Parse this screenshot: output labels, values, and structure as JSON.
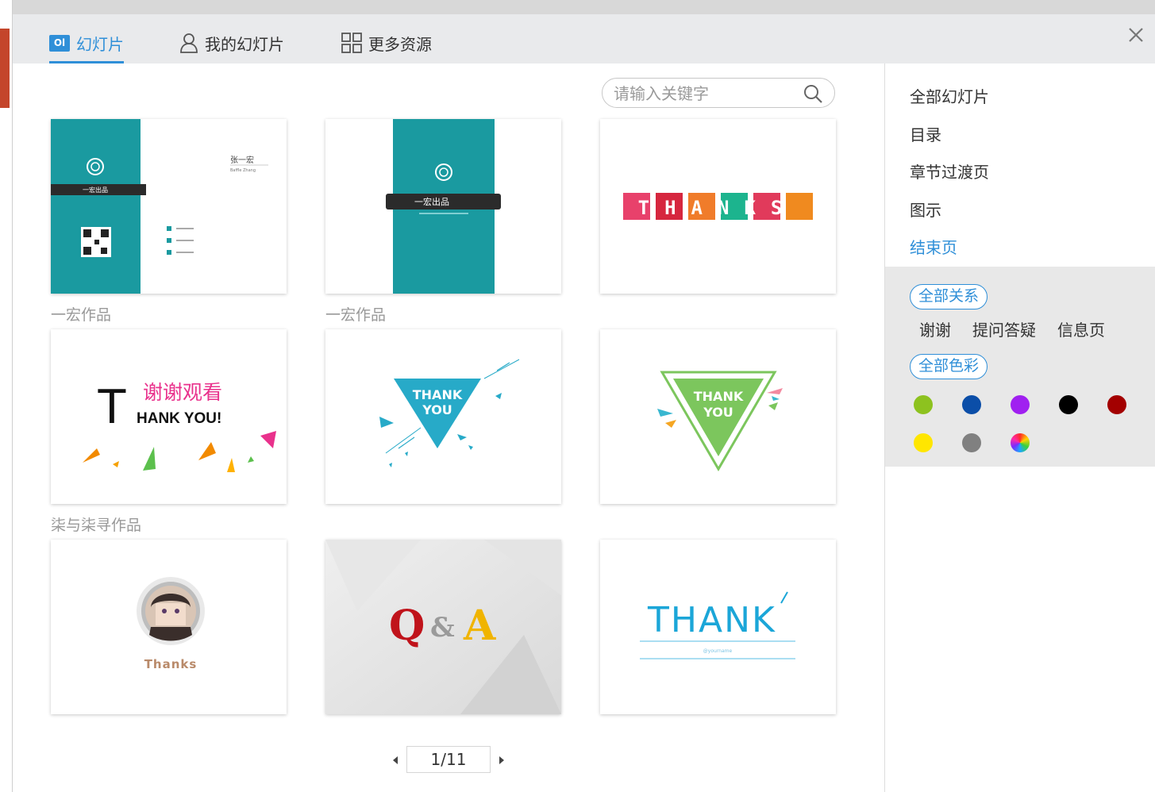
{
  "tabs": [
    {
      "label": "幻灯片",
      "icon": "slide-icon",
      "active": true
    },
    {
      "label": "我的幻灯片",
      "icon": "user-icon",
      "active": false
    },
    {
      "label": "更多资源",
      "icon": "grid-icon",
      "active": false
    }
  ],
  "tab_icon_text": "Ol",
  "search": {
    "placeholder": "请输入关键字"
  },
  "cards": [
    {
      "id": "card-1",
      "title_text": "一宏出品",
      "name_text": "张一宏",
      "name_sub": "Baffle Zhang"
    },
    {
      "id": "card-2",
      "title_text": "一宏出品"
    },
    {
      "id": "card-3",
      "text": "THANKS"
    },
    {
      "id": "card-4",
      "big_t": "T",
      "cn_text": "谢谢观看",
      "en_text": "HANK  YOU!"
    },
    {
      "id": "card-5",
      "line1": "THANK",
      "line2": "YOU"
    },
    {
      "id": "card-6",
      "line1": "THANK",
      "line2": "YOU"
    },
    {
      "id": "card-7",
      "label": "Thanks"
    },
    {
      "id": "card-8",
      "q": "Q",
      "amp": "&",
      "a": "A"
    },
    {
      "id": "card-9",
      "text": "THANK",
      "sub": "@yourname"
    }
  ],
  "authors": [
    "一宏作品",
    "一宏作品",
    "柒与柒寻作品"
  ],
  "pager": {
    "current": "1/11"
  },
  "categories": [
    {
      "label": "全部幻灯片",
      "active": false
    },
    {
      "label": "目录",
      "active": false
    },
    {
      "label": "章节过渡页",
      "active": false
    },
    {
      "label": "图示",
      "active": false
    },
    {
      "label": "结束页",
      "active": true
    }
  ],
  "relations": {
    "all_label": "全部关系",
    "items": [
      "谢谢",
      "提问答疑",
      "信息页"
    ]
  },
  "colors": {
    "all_label": "全部色彩",
    "swatches": [
      "#8dc21f",
      "#0b4ea8",
      "#a020f0",
      "#000000",
      "#a30000",
      "#ffe600",
      "#808080",
      "rainbow"
    ]
  },
  "accent": "#2f8fd8"
}
